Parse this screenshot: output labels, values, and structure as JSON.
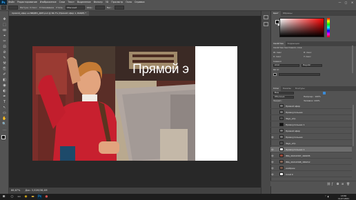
{
  "menubar": {
    "logo": "Ps",
    "items": [
      "Файл",
      "Редактирование",
      "Изображение",
      "Слои",
      "Текст",
      "Выделение",
      "Фильтр",
      "3D",
      "Просмотр",
      "Окно",
      "Справка"
    ],
    "min_icon": "—",
    "max_icon": "▢",
    "close_icon": "✕"
  },
  "options": {
    "feather_label": "Растуш.: 0 пикс",
    "antialias_label": "Сглаживание",
    "style_label": "Стиль:",
    "style_value": "Обычный",
    "width_label": "Шир.:",
    "height_label": "Выс.:"
  },
  "document": {
    "tab_title": "прямой_эфир на ВИДЕО_ДОП.psd @ 66,7% (Прямой эфир 1, RGB/8) *",
    "headline": "Прямой э",
    "zoom": "66,67%",
    "status_doc": "Док: 3,52M/38,4M"
  },
  "tools": [
    "✥",
    "⬚",
    "ꝏ",
    "⌖",
    "✂",
    "⊡",
    "⊘",
    "✎",
    "⚒",
    "⎘",
    "✐",
    "◧",
    "◉",
    "◐",
    "✒",
    "T",
    "↖",
    "▭",
    "✋",
    "🔍",
    "…"
  ],
  "panels": {
    "color_tabs": [
      "Цвет",
      "Образцы"
    ],
    "props_tabs": [
      "Свойства",
      "Коррекция"
    ],
    "props_title": "Свойства текстового слоя",
    "props_rows": [
      "W: пикс",
      "H: пикс",
      "X: пикс",
      "Y: пикс"
    ],
    "char_label": "Символ",
    "font_name": "Arial",
    "font_style": "Regular",
    "size_label": "69 пт",
    "layers_tabs": [
      "Слои",
      "Каналы",
      "Контуры"
    ],
    "kind_label": "Вид",
    "blend_label": "Обычные",
    "opacity_label": "Непрозр.: 100%",
    "lock_label": "Закреп.:",
    "fill_label": "Заливка: 100%"
  },
  "layers": [
    {
      "name": "Прямой эфир",
      "visible": false,
      "selected": false
    },
    {
      "name": "Прямоугольник",
      "visible": false,
      "selected": false
    },
    {
      "name": "Звук_итр",
      "visible": false,
      "selected": false
    },
    {
      "name": "Прямоугольник 1",
      "visible": false,
      "selected": false
    },
    {
      "name": "Прямой эфир",
      "visible": false,
      "selected": false
    },
    {
      "name": "Прямоугольник",
      "visible": true,
      "selected": false
    },
    {
      "name": "Звук_итр",
      "visible": false,
      "selected": false
    },
    {
      "name": "Прямоугольник 1",
      "visible": true,
      "selected": true
    },
    {
      "name": "IMG_20210307_160935",
      "visible": true,
      "selected": false
    },
    {
      "name": "IMG_20210308_180212",
      "visible": true,
      "selected": false
    },
    {
      "name": "изображ",
      "visible": true,
      "selected": false
    },
    {
      "name": "Слой 0",
      "visible": true,
      "selected": false
    }
  ],
  "taskbar": {
    "start_icon": "⊞",
    "time": "13:56",
    "date": "11.07.2021"
  }
}
